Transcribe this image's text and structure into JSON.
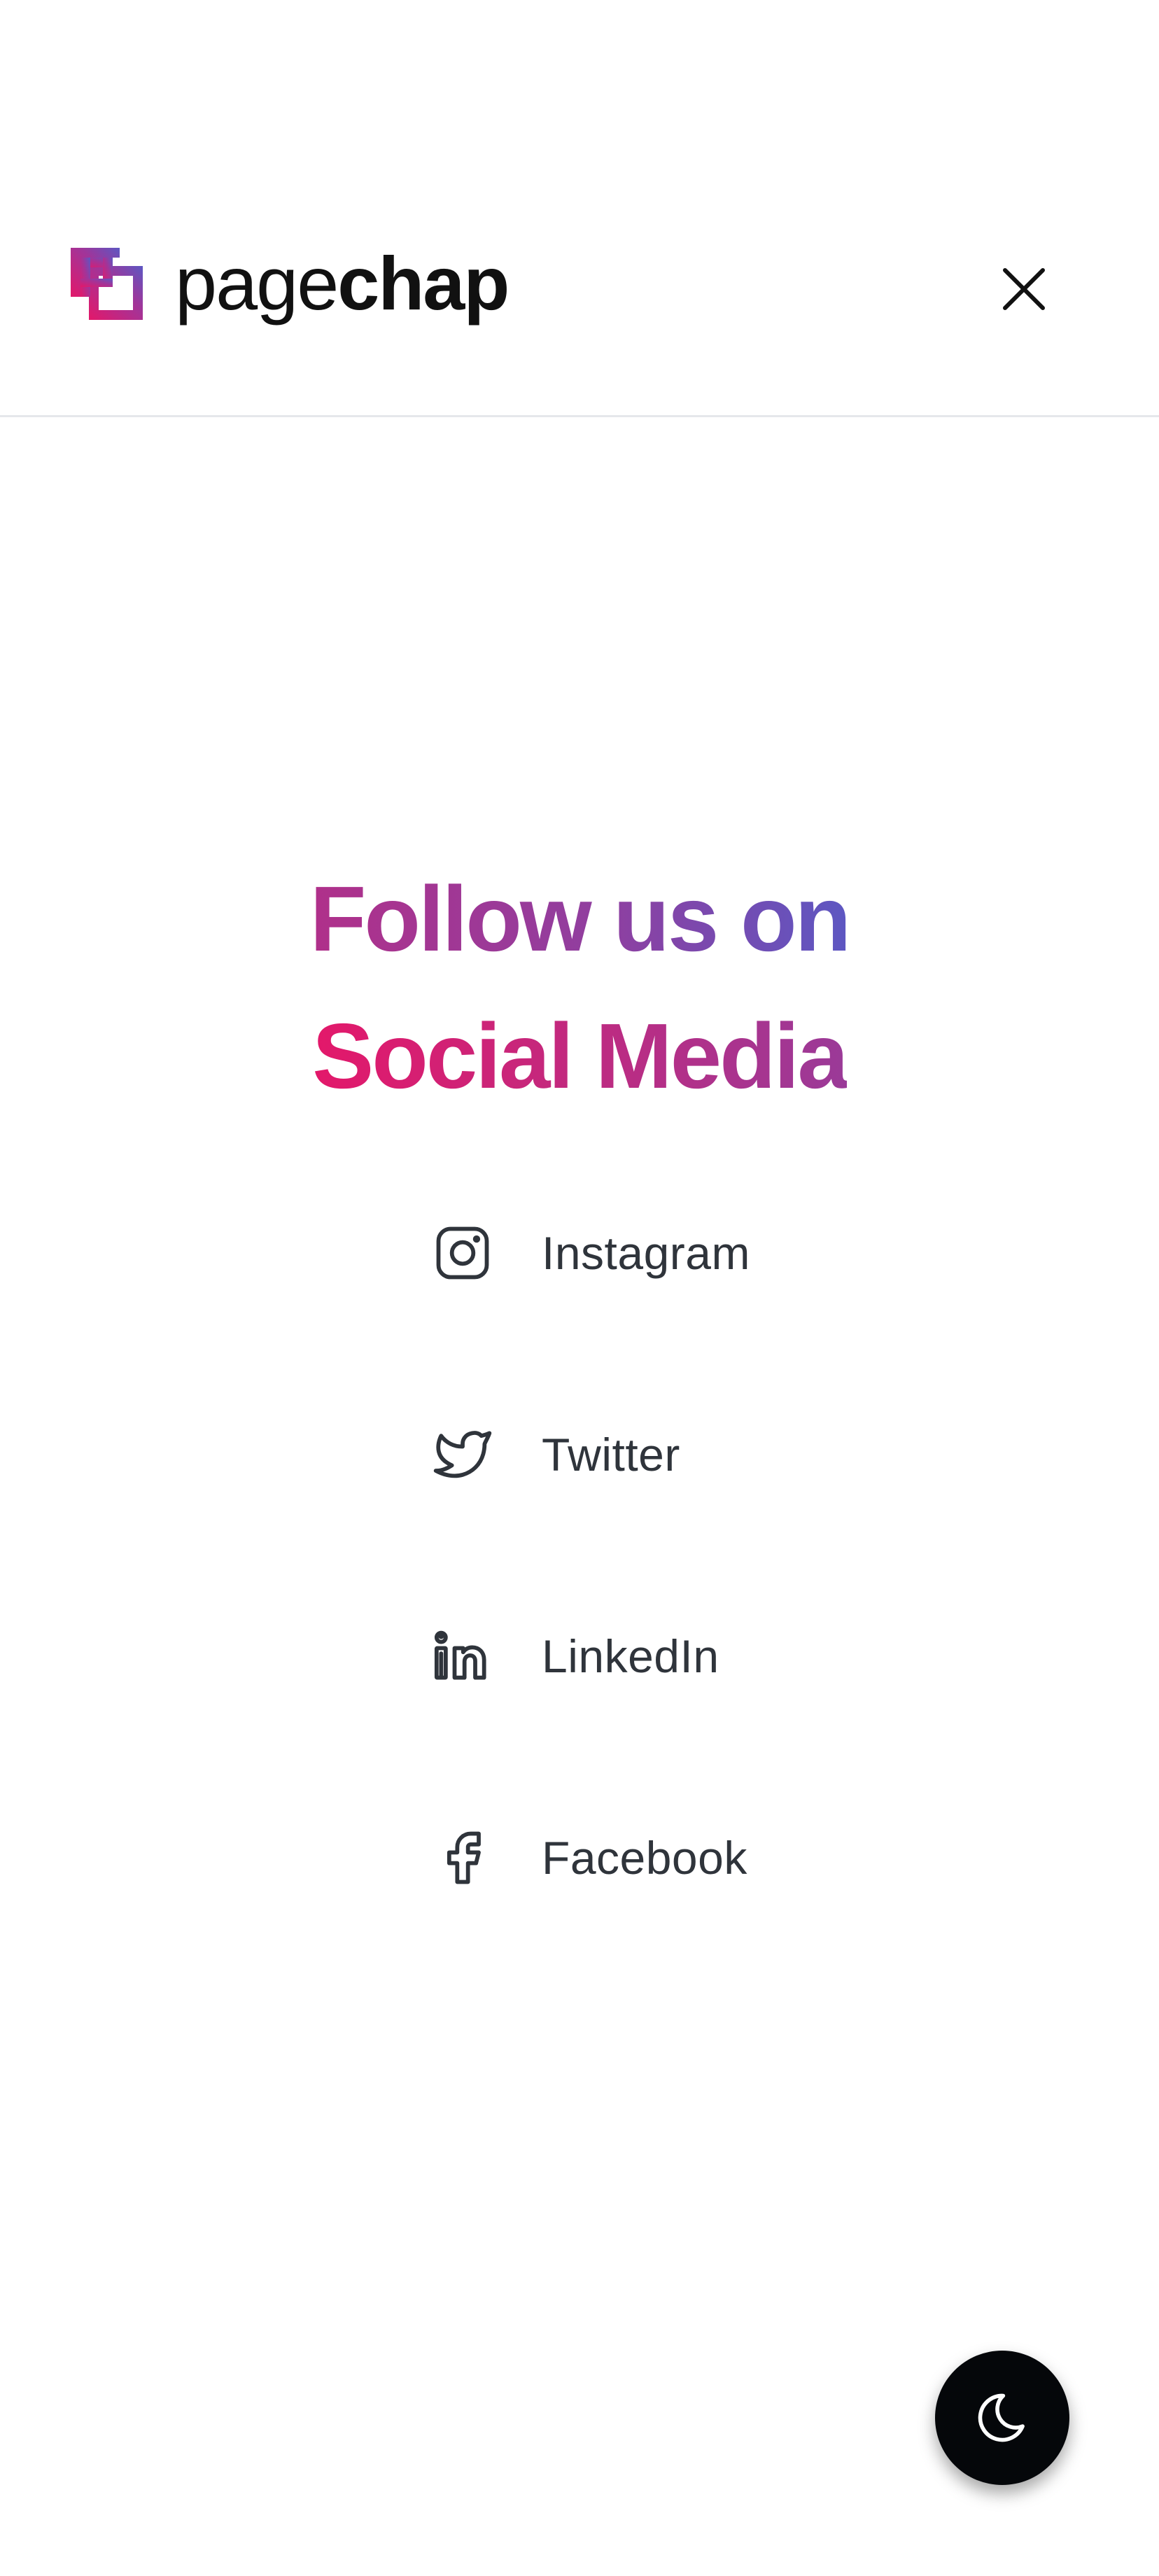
{
  "header": {
    "logo": {
      "text_light": "page",
      "text_bold": "chap",
      "mark_icon": "pagechap-logo-mark-icon",
      "colors": {
        "gradient_start": "#e3186a",
        "gradient_end": "#5d57c2"
      }
    },
    "close_icon": "close-icon"
  },
  "main": {
    "heading_line1": "Follow us on",
    "heading_line2": "Social Media",
    "heading_colors": {
      "line1_start": "#b0308a",
      "line1_end": "#5d57c2",
      "line2_start": "#e3186a",
      "line2_end": "#9a3a98"
    },
    "social_links": [
      {
        "label": "Instagram",
        "icon": "instagram-icon"
      },
      {
        "label": "Twitter",
        "icon": "twitter-icon"
      },
      {
        "label": "LinkedIn",
        "icon": "linkedin-icon"
      },
      {
        "label": "Facebook",
        "icon": "facebook-icon"
      }
    ]
  },
  "theme_toggle": {
    "icon": "moon-icon",
    "background": "#05070a"
  }
}
